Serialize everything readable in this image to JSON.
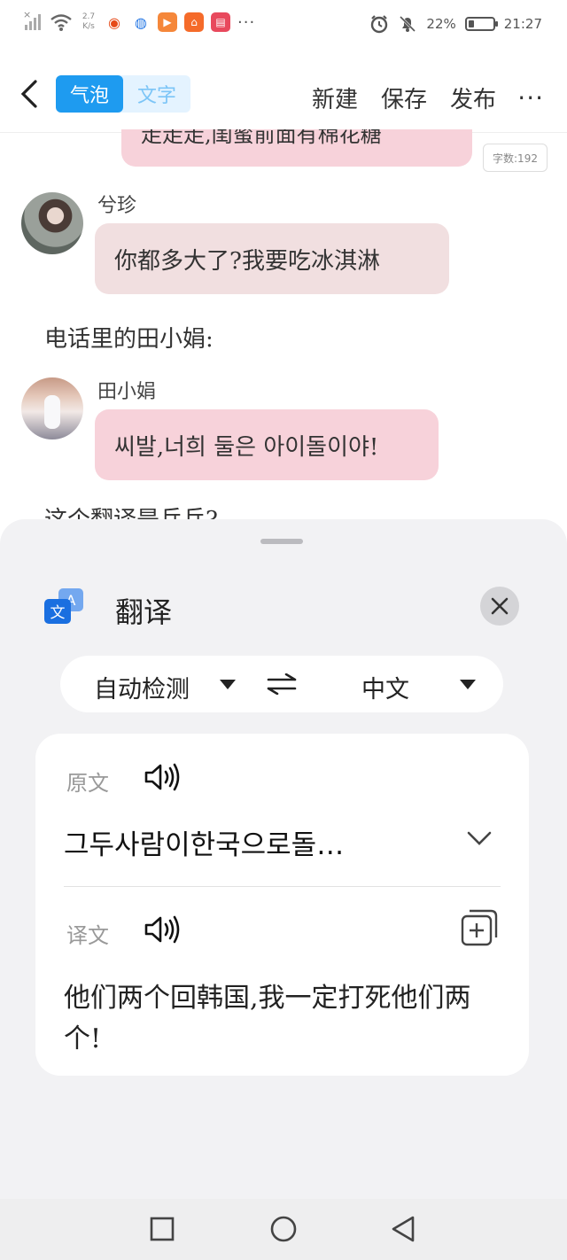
{
  "status_bar": {
    "network_speed_value": "2.7",
    "network_speed_unit": "K/s",
    "battery_percent": "22%",
    "battery_level": 0.22,
    "time": "21:27",
    "overflow": "···"
  },
  "nav": {
    "tab_bubble": "气泡",
    "tab_text": "文字",
    "new_label": "新建",
    "save_label": "保存",
    "publish_label": "发布",
    "more": "···"
  },
  "chat": {
    "prev_bubble_text": "走走走,闺蜜前面有棉花糖",
    "word_count": "字数:192",
    "messages": [
      {
        "speaker": "兮珍",
        "text": "你都多大了?我要吃冰淇淋"
      },
      {
        "speaker": "田小娟",
        "text": "씨발,너희 둘은 아이돌이야!"
      }
    ],
    "narration": "电话里的田小娟:",
    "narration_cut": "这个翻译是乒乓?"
  },
  "translate": {
    "title": "翻译",
    "source_lang": "自动检测",
    "target_lang": "中文",
    "original_label": "原文",
    "original_text": "그두사람이한국으로돌…",
    "translation_label": "译文",
    "translation_text": "他们两个回韩国,我一定打死他们两个!"
  },
  "colors": {
    "accent_blue": "#1e9bf0",
    "bubble_pink": "#f7d2da",
    "bubble_light": "#f1dfe0",
    "sheet_bg": "#f2f2f4"
  }
}
